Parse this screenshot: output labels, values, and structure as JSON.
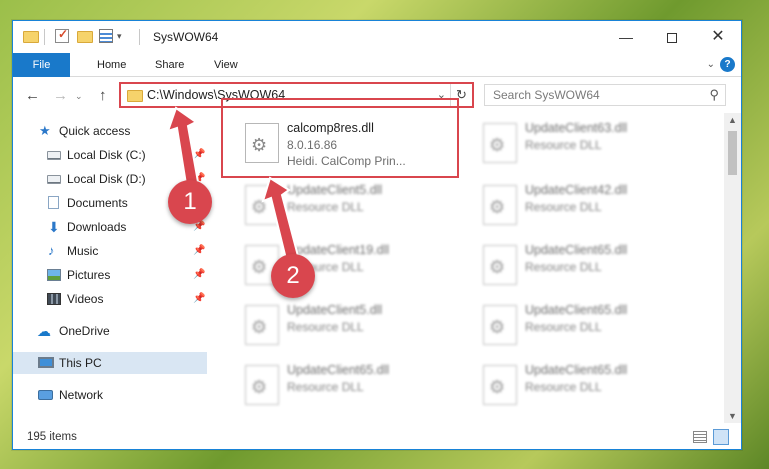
{
  "window": {
    "title": "SysWOW64",
    "minimize_label": "—",
    "close_label": "✕"
  },
  "ribbon": {
    "tabs": [
      "File",
      "Home",
      "Share",
      "View"
    ],
    "expand_icon": "⌄",
    "help_label": "?"
  },
  "navbar": {
    "back_icon": "←",
    "forward_icon": "→",
    "recent_icon": "⌄",
    "up_icon": "↑",
    "address": "C:\\Windows\\SysWOW64",
    "dropdown_icon": "⌄",
    "refresh_icon": "↻",
    "search_placeholder": "Search SysWOW64",
    "search_icon": "⚲"
  },
  "sidebar": {
    "pin_icon": "📌",
    "items": [
      {
        "label": "Quick access",
        "icon": "star-icon",
        "pinned": false
      },
      {
        "label": "Local Disk (C:)",
        "icon": "disk-icon",
        "pinned": true
      },
      {
        "label": "Local Disk (D:)",
        "icon": "disk-icon",
        "pinned": true
      },
      {
        "label": "Documents",
        "icon": "documents-icon",
        "pinned": true
      },
      {
        "label": "Downloads",
        "icon": "downloads-icon",
        "pinned": true
      },
      {
        "label": "Music",
        "icon": "music-icon",
        "pinned": true
      },
      {
        "label": "Pictures",
        "icon": "pictures-icon",
        "pinned": true
      },
      {
        "label": "Videos",
        "icon": "videos-icon",
        "pinned": true
      },
      {
        "label": "OneDrive",
        "icon": "onedrive-icon",
        "pinned": false
      },
      {
        "label": "This PC",
        "icon": "this-pc-icon",
        "pinned": false,
        "selected": true
      },
      {
        "label": "Network",
        "icon": "network-icon",
        "pinned": false
      }
    ]
  },
  "files": [
    {
      "name": "calcomp8res.dll",
      "line1": "8.0.16.86",
      "line2": "Heidi. CalComp Prin...",
      "highlighted": true
    },
    {
      "name": "UpdateClient63.dll",
      "line1": "Resource DLL"
    },
    {
      "name": "UpdateClient5.dll",
      "line1": "Resource DLL"
    },
    {
      "name": "UpdateClient42.dll",
      "line1": "Resource DLL"
    },
    {
      "name": "UpdateClient19.dll",
      "line1": "Resource DLL"
    },
    {
      "name": "UpdateClient65.dll",
      "line1": "Resource DLL"
    },
    {
      "name": "UpdateClient5.dll",
      "line1": "Resource DLL"
    },
    {
      "name": "UpdateClient65.dll",
      "line1": "Resource DLL"
    },
    {
      "name": "UpdateClient65.dll",
      "line1": "Resource DLL"
    },
    {
      "name": "UpdateClient65.dll",
      "line1": "Resource DLL"
    }
  ],
  "gear_icon": "⚙",
  "statusbar": {
    "item_count": "195 items"
  },
  "callouts": {
    "step1": "1",
    "step2": "2",
    "color": "#d9464e"
  },
  "colors": {
    "accent": "#1979ca",
    "highlight": "#d9464e",
    "selected_bg": "#d9e6f3"
  }
}
